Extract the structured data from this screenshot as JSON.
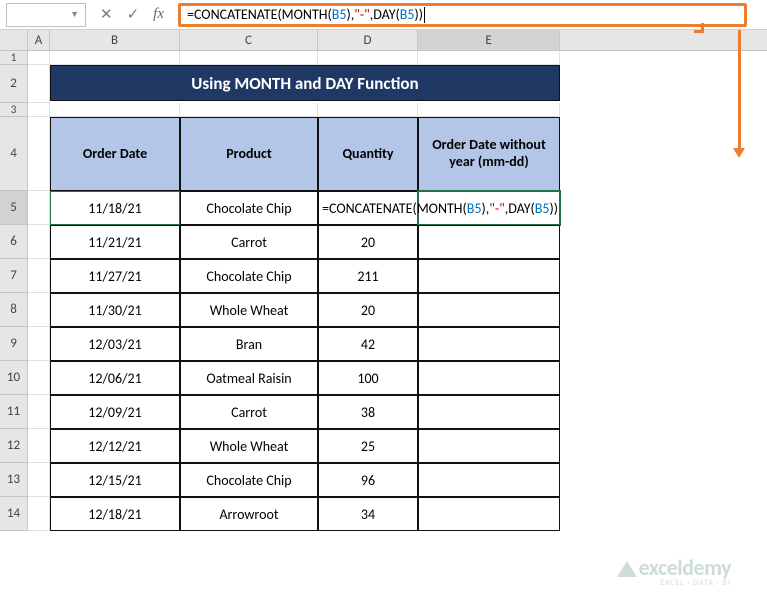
{
  "namebox": "",
  "formula": {
    "pre": "=CONCATENATE(MONTH(",
    "b5a": "B5",
    "mid": "),",
    "dash": "\"-\"",
    "mid2": ",DAY(",
    "b5b": "B5",
    "post": "))"
  },
  "columns": {
    "A": "A",
    "B": "B",
    "C": "C",
    "D": "D",
    "E": "E"
  },
  "rowlabels": [
    "1",
    "2",
    "3",
    "4",
    "5",
    "6",
    "7",
    "8",
    "9",
    "10",
    "11",
    "12",
    "13",
    "14"
  ],
  "title": "Using MONTH and DAY Function",
  "headers": {
    "date": "Order Date",
    "product": "Product",
    "qty": "Quantity",
    "result": "Order Date without year (mm-dd)"
  },
  "rows": [
    {
      "date": "11/18/21",
      "product": "Chocolate Chip",
      "qty": ""
    },
    {
      "date": "11/21/21",
      "product": "Carrot",
      "qty": "20"
    },
    {
      "date": "11/27/21",
      "product": "Chocolate Chip",
      "qty": "211"
    },
    {
      "date": "11/30/21",
      "product": "Whole Wheat",
      "qty": "20"
    },
    {
      "date": "12/03/21",
      "product": "Bran",
      "qty": "42"
    },
    {
      "date": "12/06/21",
      "product": "Oatmeal Raisin",
      "qty": "100"
    },
    {
      "date": "12/09/21",
      "product": "Carrot",
      "qty": "38"
    },
    {
      "date": "12/12/21",
      "product": "Whole Wheat",
      "qty": "25"
    },
    {
      "date": "12/15/21",
      "product": "Chocolate Chip",
      "qty": "96"
    },
    {
      "date": "12/18/21",
      "product": "Arrowroot",
      "qty": "34"
    }
  ],
  "cell_formula": {
    "pre": "=CONCATENATE(MONTH(",
    "b5a": "B5",
    "mid": "),",
    "dash": "\"-\"",
    "mid2": ",DAY(",
    "b5b": "B5",
    "post": "))"
  },
  "watermark": {
    "brand": "exceldemy",
    "sub": "EXCEL · DATA · BI"
  },
  "chart_data": {
    "type": "table",
    "title": "Using MONTH and DAY Function",
    "columns": [
      "Order Date",
      "Product",
      "Quantity",
      "Order Date without year (mm-dd)"
    ],
    "rows": [
      [
        "11/18/21",
        "Chocolate Chip",
        null,
        null
      ],
      [
        "11/21/21",
        "Carrot",
        20,
        null
      ],
      [
        "11/27/21",
        "Chocolate Chip",
        211,
        null
      ],
      [
        "11/30/21",
        "Whole Wheat",
        20,
        null
      ],
      [
        "12/03/21",
        "Bran",
        42,
        null
      ],
      [
        "12/06/21",
        "Oatmeal Raisin",
        100,
        null
      ],
      [
        "12/09/21",
        "Carrot",
        38,
        null
      ],
      [
        "12/12/21",
        "Whole Wheat",
        25,
        null
      ],
      [
        "12/15/21",
        "Chocolate Chip",
        96,
        null
      ],
      [
        "12/18/21",
        "Arrowroot",
        34,
        null
      ]
    ]
  }
}
